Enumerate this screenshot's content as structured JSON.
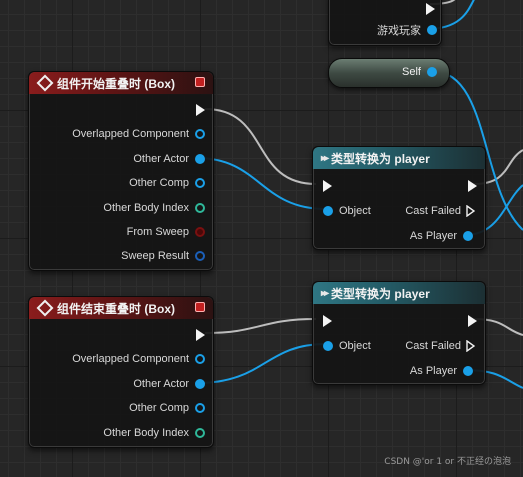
{
  "top_node": {
    "pin_label": "游戏玩家"
  },
  "self_node": {
    "label": "Self"
  },
  "begin_overlap": {
    "title": "组件开始重叠时 (Box)",
    "pins": [
      "Overlapped Component",
      "Other Actor",
      "Other Comp",
      "Other Body Index",
      "From Sweep",
      "Sweep Result"
    ]
  },
  "end_overlap": {
    "title": "组件结束重叠时 (Box)",
    "pins": [
      "Overlapped Component",
      "Other Actor",
      "Other Comp",
      "Other Body Index"
    ]
  },
  "cast_1": {
    "title": "类型转换为 player",
    "object_label": "Object",
    "cast_failed_label": "Cast Failed",
    "as_player_label": "As Player"
  },
  "cast_2": {
    "title": "类型转换为 player",
    "object_label": "Object",
    "cast_failed_label": "Cast Failed",
    "as_player_label": "As Player"
  },
  "watermark": "CSDN @'or 1 or 不正经の泡泡",
  "colors": {
    "exec_wire": "#c8c8c8",
    "object_wire": "#1aa0e8",
    "event_header": "#8a1d1d",
    "cast_header": "#2f7683",
    "object_pin": "#1aa0e8",
    "int_pin": "#2fb89a",
    "bool_pin": "#7a1010",
    "struct_pin": "#1b5fb8"
  }
}
